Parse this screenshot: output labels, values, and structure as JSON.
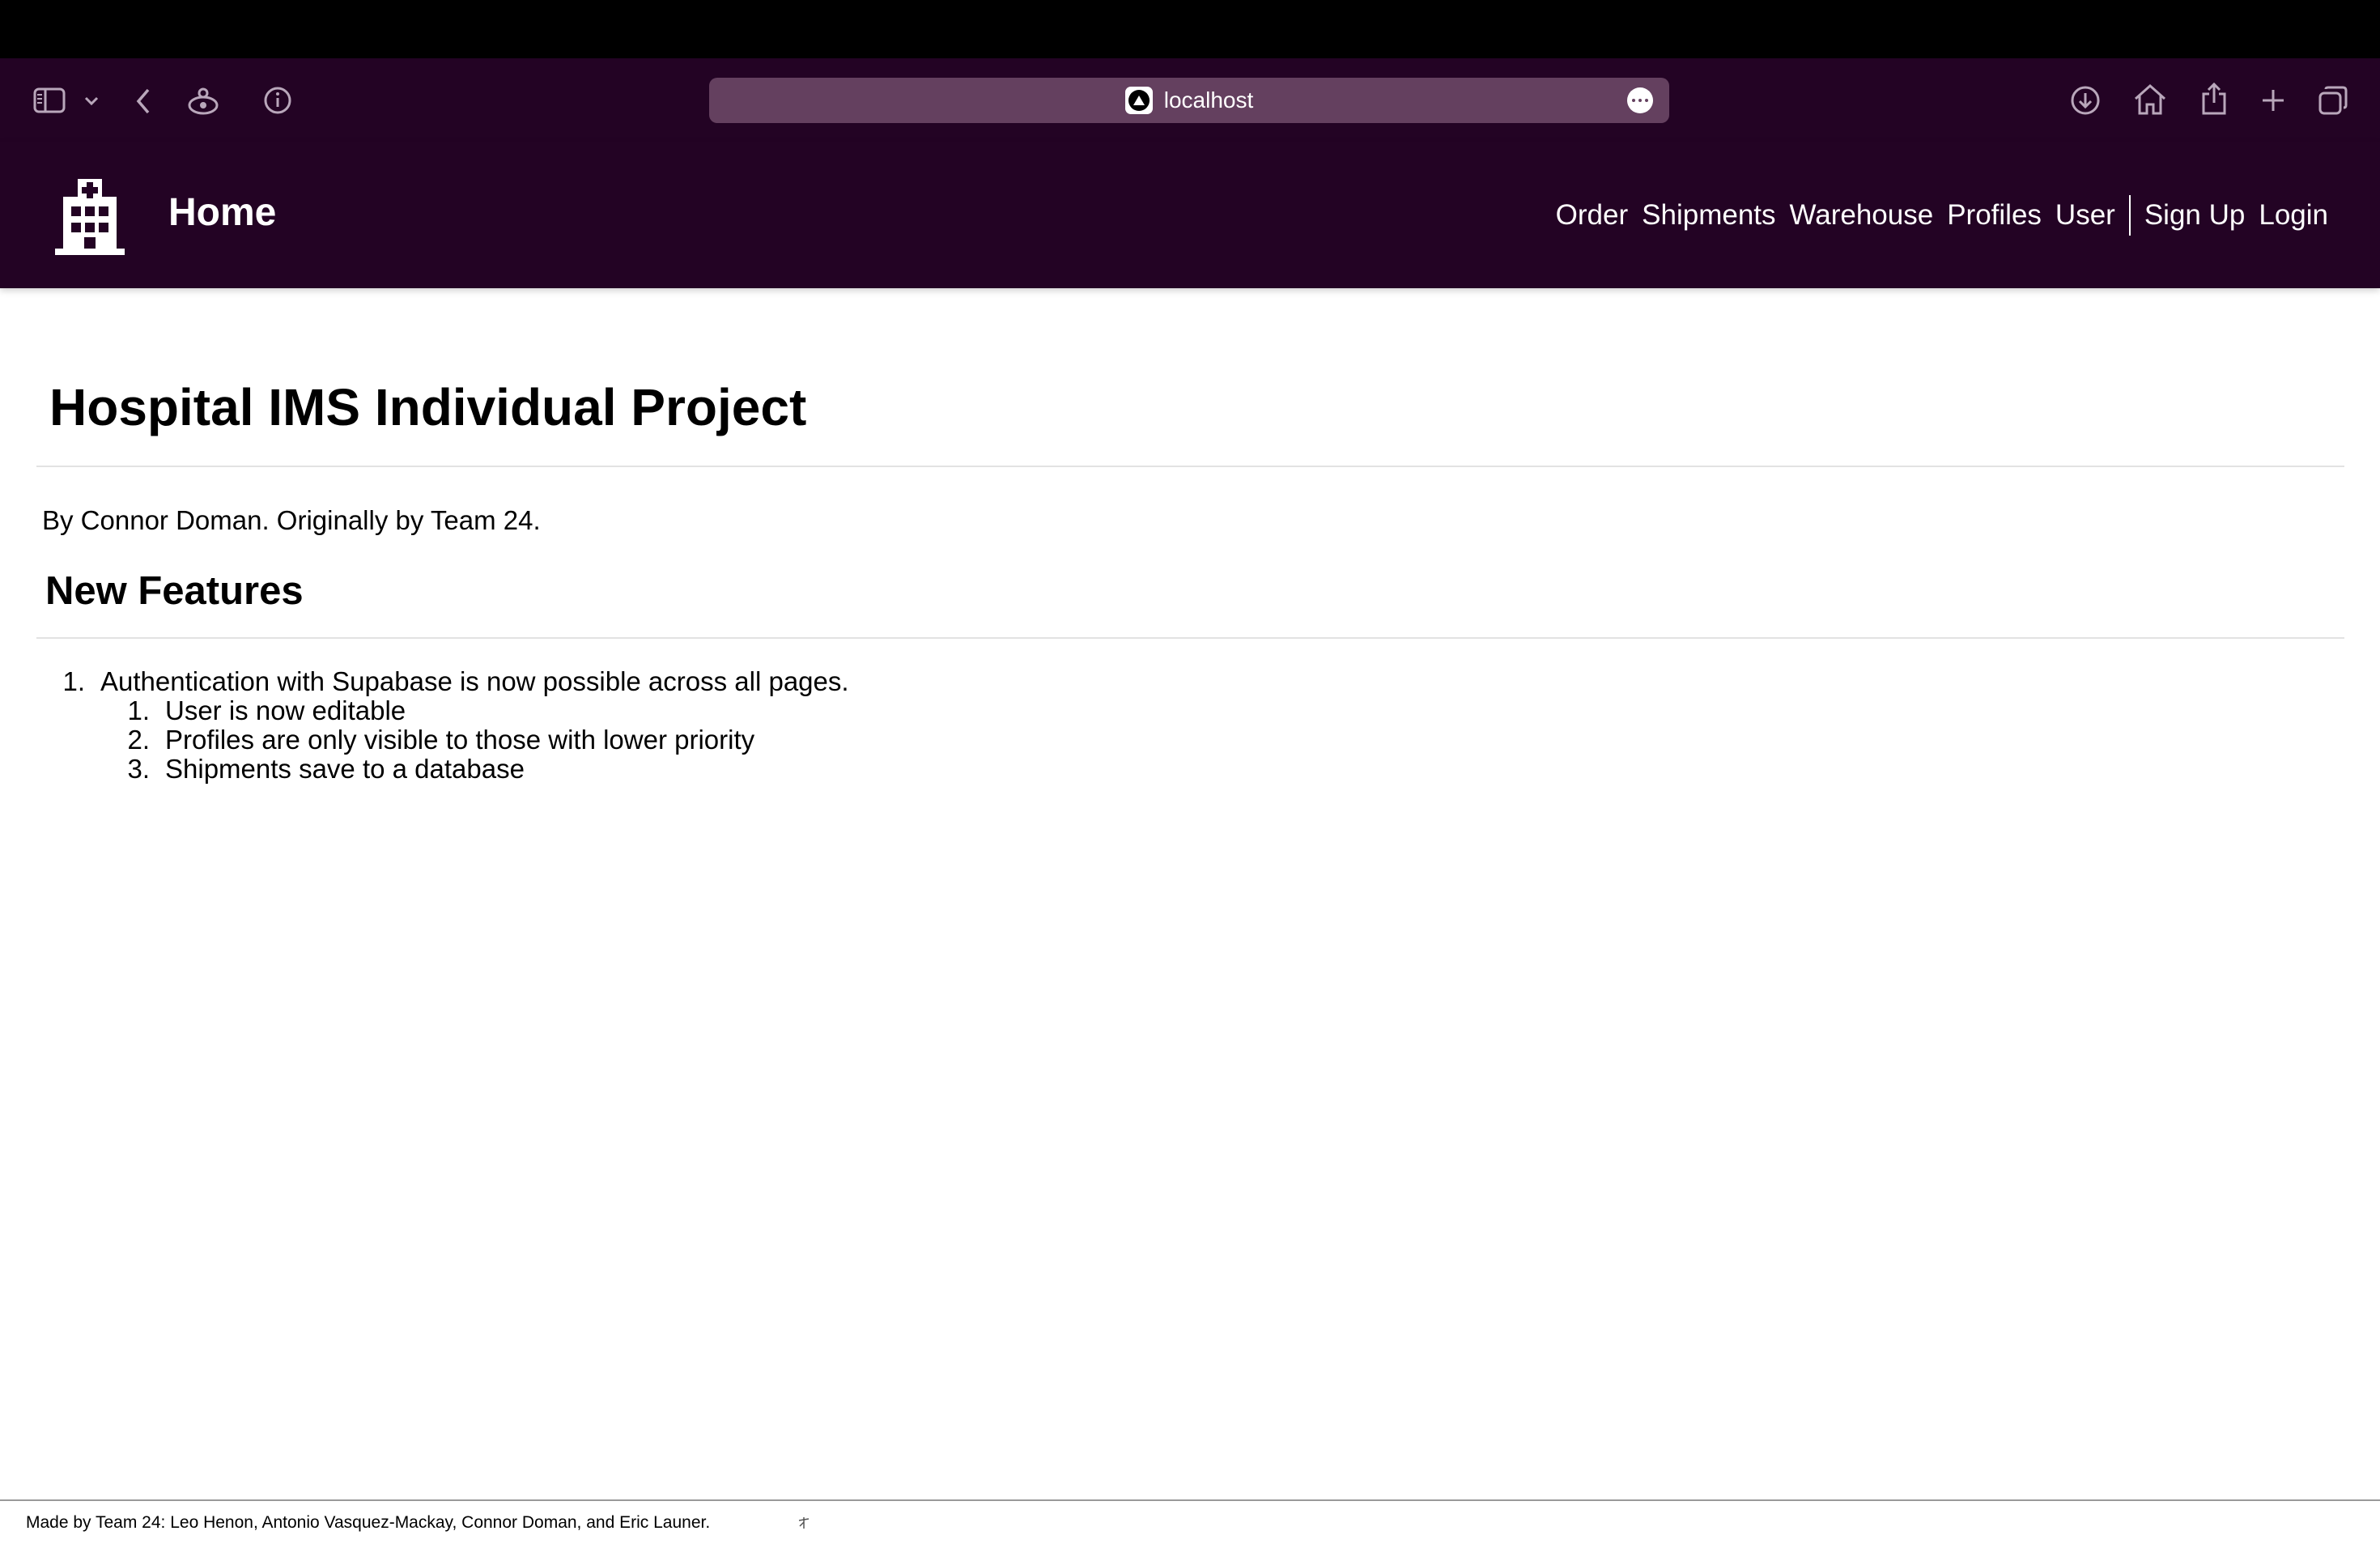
{
  "browser": {
    "url": "localhost",
    "icons": [
      "sidebar-icon",
      "chevron-down-icon",
      "back-icon",
      "reader-icon",
      "info-icon",
      "more-icon",
      "download-icon",
      "home-icon",
      "share-icon",
      "plus-icon",
      "tabs-icon"
    ]
  },
  "app": {
    "brand": "Home",
    "logo_icon": "hospital-icon",
    "nav": {
      "order": "Order",
      "shipments": "Shipments",
      "warehouse": "Warehouse",
      "profiles": "Profiles",
      "user": "User",
      "signup": "Sign Up",
      "login": "Login"
    },
    "colors": {
      "nav_background": "#230324",
      "address_bar": "#64405f"
    }
  },
  "content": {
    "title": "Hospital IMS Individual Project",
    "byline": "By Connor Doman. Originally by Team 24.",
    "section_title": "New Features",
    "features": [
      {
        "num": "1.",
        "text": "Authentication with Supabase is now possible across all pages.",
        "sub": [
          {
            "num": "1.",
            "text": "User is now editable"
          },
          {
            "num": "2.",
            "text": "Profiles are only visible to those with lower priority"
          },
          {
            "num": "3.",
            "text": "Shipments save to a database"
          }
        ]
      }
    ]
  },
  "footer": {
    "text": "Made by Team 24: Leo Henon, Antonio Vasquez-Mackay, Connor Doman, and Eric Launer."
  }
}
